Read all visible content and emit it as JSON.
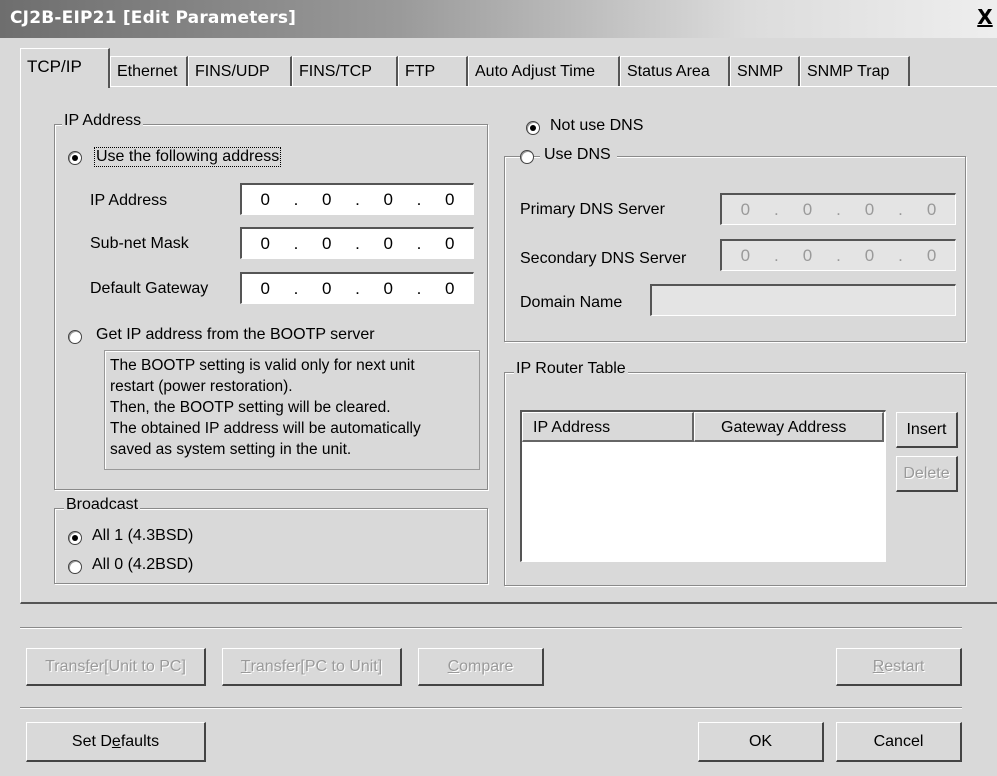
{
  "window": {
    "title": "CJ2B-EIP21 [Edit Parameters]",
    "close_label": "X"
  },
  "tabs": [
    {
      "label": "TCP/IP",
      "active": true
    },
    {
      "label": "Ethernet"
    },
    {
      "label": "FINS/UDP"
    },
    {
      "label": "FINS/TCP"
    },
    {
      "label": "FTP"
    },
    {
      "label": "Auto Adjust Time"
    },
    {
      "label": "Status Area"
    },
    {
      "label": "SNMP"
    },
    {
      "label": "SNMP Trap"
    }
  ],
  "ip_address": {
    "group_label": "IP Address",
    "use_following_label": "Use the following address",
    "use_following_selected": true,
    "fields": [
      {
        "label": "IP Address",
        "octets": [
          "0",
          "0",
          "0",
          "0"
        ]
      },
      {
        "label": "Sub-net Mask",
        "octets": [
          "0",
          "0",
          "0",
          "0"
        ]
      },
      {
        "label": "Default Gateway",
        "octets": [
          "0",
          "0",
          "0",
          "0"
        ]
      }
    ],
    "bootp_label": "Get IP address from the BOOTP server",
    "bootp_info": [
      "The BOOTP setting is valid only for next unit",
      "restart (power restoration).",
      "Then, the BOOTP setting will be cleared.",
      "The obtained IP address will be automatically",
      "saved as system setting in the unit."
    ]
  },
  "broadcast": {
    "group_label": "Broadcast",
    "options": [
      {
        "label": "All 1 (4.3BSD)",
        "selected": true
      },
      {
        "label": "All 0 (4.2BSD)",
        "selected": false
      }
    ]
  },
  "dns": {
    "not_use_label": "Not use DNS",
    "not_use_selected": true,
    "use_label": "Use DNS",
    "primary_label": "Primary DNS Server",
    "primary_octets": [
      "0",
      "0",
      "0",
      "0"
    ],
    "secondary_label": "Secondary DNS Server",
    "secondary_octets": [
      "0",
      "0",
      "0",
      "0"
    ],
    "domain_label": "Domain Name",
    "domain_value": ""
  },
  "router_table": {
    "group_label": "IP Router Table",
    "columns": [
      "IP Address",
      "Gateway Address"
    ],
    "insert_label": "Insert",
    "delete_label": "Delete"
  },
  "buttons": {
    "transfer_unit_to_pc": {
      "pre": "Trans",
      "key": "f",
      "post": "er[Unit to PC]"
    },
    "transfer_pc_to_unit": {
      "pre": "",
      "key": "T",
      "post": "ransfer[PC to Unit]"
    },
    "compare": {
      "pre": "",
      "key": "C",
      "post": "ompare"
    },
    "restart": {
      "pre": "",
      "key": "R",
      "post": "estart"
    },
    "set_defaults": {
      "pre": "Set D",
      "key": "e",
      "post": "faults"
    },
    "ok": "OK",
    "cancel": "Cancel"
  },
  "colors": {
    "dialog_bg": "#d9d9d9",
    "disabled_text": "#9a9a9a"
  }
}
